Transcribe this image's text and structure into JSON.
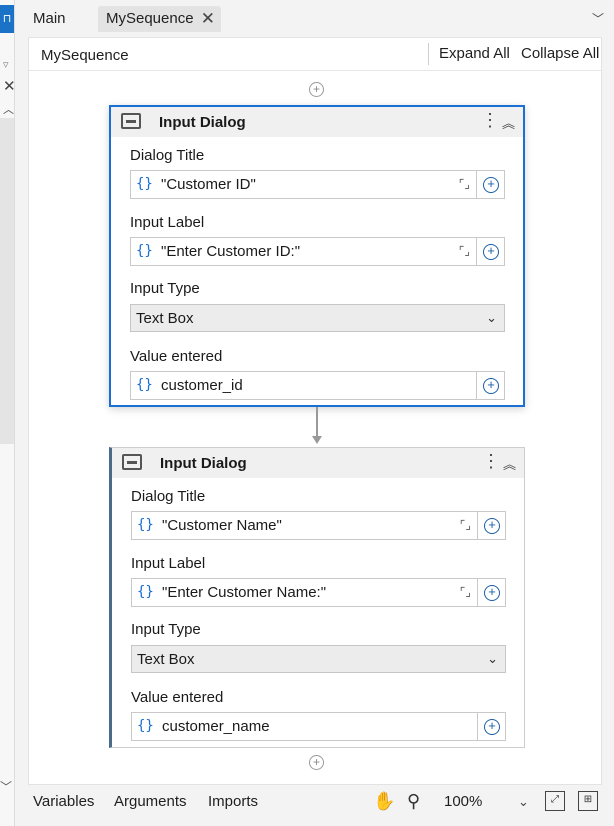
{
  "tabs": {
    "main": "Main",
    "sequence": "MySequence"
  },
  "designer": {
    "title": "MySequence",
    "expand_all": "Expand All",
    "collapse_all": "Collapse All"
  },
  "activities": [
    {
      "title": "Input Dialog",
      "dialog_title_label": "Dialog Title",
      "dialog_title_value": "\"Customer ID\"",
      "input_label_label": "Input Label",
      "input_label_value": "\"Enter Customer ID:\"",
      "input_type_label": "Input Type",
      "input_type_value": "Text Box",
      "value_entered_label": "Value entered",
      "value_entered_value": "customer_id"
    },
    {
      "title": "Input Dialog",
      "dialog_title_label": "Dialog Title",
      "dialog_title_value": "\"Customer Name\"",
      "input_label_label": "Input Label",
      "input_label_value": "\"Enter Customer Name:\"",
      "input_type_label": "Input Type",
      "input_type_value": "Text Box",
      "value_entered_label": "Value entered",
      "value_entered_value": "customer_name"
    }
  ],
  "bottom": {
    "variables": "Variables",
    "arguments": "Arguments",
    "imports": "Imports",
    "zoom": "100%"
  },
  "colors": {
    "accent": "#1a6fd4",
    "left_panel_accent": "#1a73c6"
  }
}
